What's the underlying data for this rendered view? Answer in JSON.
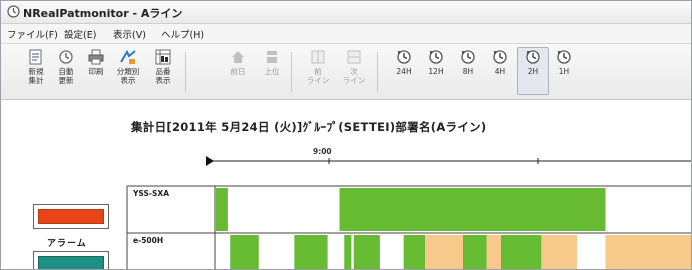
{
  "window": {
    "title": "NRealPatmonitor - Aライン"
  },
  "menu": [
    {
      "label": "ファイル(F)"
    },
    {
      "label": "設定(E)"
    },
    {
      "label": "表示(V)"
    },
    {
      "label": "ヘルプ(H)"
    }
  ],
  "toolbar": {
    "buttons": [
      {
        "label": "新規\n集計",
        "icon": "new-tally-icon",
        "enabled": true
      },
      {
        "label": "自動\n更新",
        "icon": "auto-refresh-icon",
        "enabled": true
      },
      {
        "label": "印刷",
        "icon": "print-icon",
        "enabled": true
      },
      {
        "label": "分類別\n表示",
        "icon": "category-view-icon",
        "enabled": true
      },
      {
        "label": "品番\n表示",
        "icon": "part-number-icon",
        "enabled": true
      },
      {
        "label": "前日",
        "icon": "previous-day-icon",
        "enabled": false
      },
      {
        "label": "上位",
        "icon": "up-icon",
        "enabled": false
      },
      {
        "label": "前\nライン",
        "icon": "previous-line-icon",
        "enabled": false
      },
      {
        "label": "次\nライン",
        "icon": "next-line-icon",
        "enabled": false
      },
      {
        "label": "24H",
        "icon": "clock-icon",
        "enabled": true
      },
      {
        "label": "12H",
        "icon": "clock-icon",
        "enabled": true
      },
      {
        "label": "8H",
        "icon": "clock-icon",
        "enabled": true
      },
      {
        "label": "4H",
        "icon": "clock-icon",
        "enabled": true
      },
      {
        "label": "2H",
        "icon": "clock-icon",
        "enabled": true,
        "pressed": true
      },
      {
        "label": "1H",
        "icon": "clock-icon",
        "enabled": true
      }
    ]
  },
  "report": {
    "header": "集計日[2011年 5月24日 (火)]ｸﾞﾙｰﾌﾟ(SETTEI)部署名(Aライン)",
    "time_marker": "9:00"
  },
  "legend": {
    "alarm_label": "アラーム",
    "alarm_color": "#e8461a",
    "second_color": "#1e8f85"
  },
  "rows": [
    {
      "label": "YSS-SXA",
      "segments": [
        {
          "start": 0.0,
          "end": 0.025,
          "status": "run"
        },
        {
          "start": 0.025,
          "end": 0.26,
          "status": "idle"
        },
        {
          "start": 0.26,
          "end": 0.82,
          "status": "run"
        },
        {
          "start": 0.82,
          "end": 1.0,
          "status": "idle"
        }
      ]
    },
    {
      "label": "e-500H",
      "segments": [
        {
          "start": 0.0,
          "end": 0.03,
          "status": "idle"
        },
        {
          "start": 0.03,
          "end": 0.09,
          "status": "run"
        },
        {
          "start": 0.09,
          "end": 0.165,
          "status": "idle"
        },
        {
          "start": 0.165,
          "end": 0.235,
          "status": "run"
        },
        {
          "start": 0.235,
          "end": 0.27,
          "status": "idle"
        },
        {
          "start": 0.27,
          "end": 0.285,
          "status": "run"
        },
        {
          "start": 0.285,
          "end": 0.29,
          "status": "idle"
        },
        {
          "start": 0.29,
          "end": 0.345,
          "status": "run"
        },
        {
          "start": 0.345,
          "end": 0.395,
          "status": "idle"
        },
        {
          "start": 0.395,
          "end": 0.44,
          "status": "run"
        },
        {
          "start": 0.44,
          "end": 0.52,
          "status": "stop"
        },
        {
          "start": 0.52,
          "end": 0.57,
          "status": "run"
        },
        {
          "start": 0.57,
          "end": 0.6,
          "status": "stop"
        },
        {
          "start": 0.6,
          "end": 0.685,
          "status": "run"
        },
        {
          "start": 0.685,
          "end": 0.76,
          "status": "stop"
        },
        {
          "start": 0.76,
          "end": 0.82,
          "status": "idle"
        },
        {
          "start": 0.82,
          "end": 1.0,
          "status": "stop"
        }
      ]
    }
  ],
  "status_colors": {
    "run": "#66bb33",
    "idle": "#ffffff",
    "stop": "#f7c98a"
  }
}
